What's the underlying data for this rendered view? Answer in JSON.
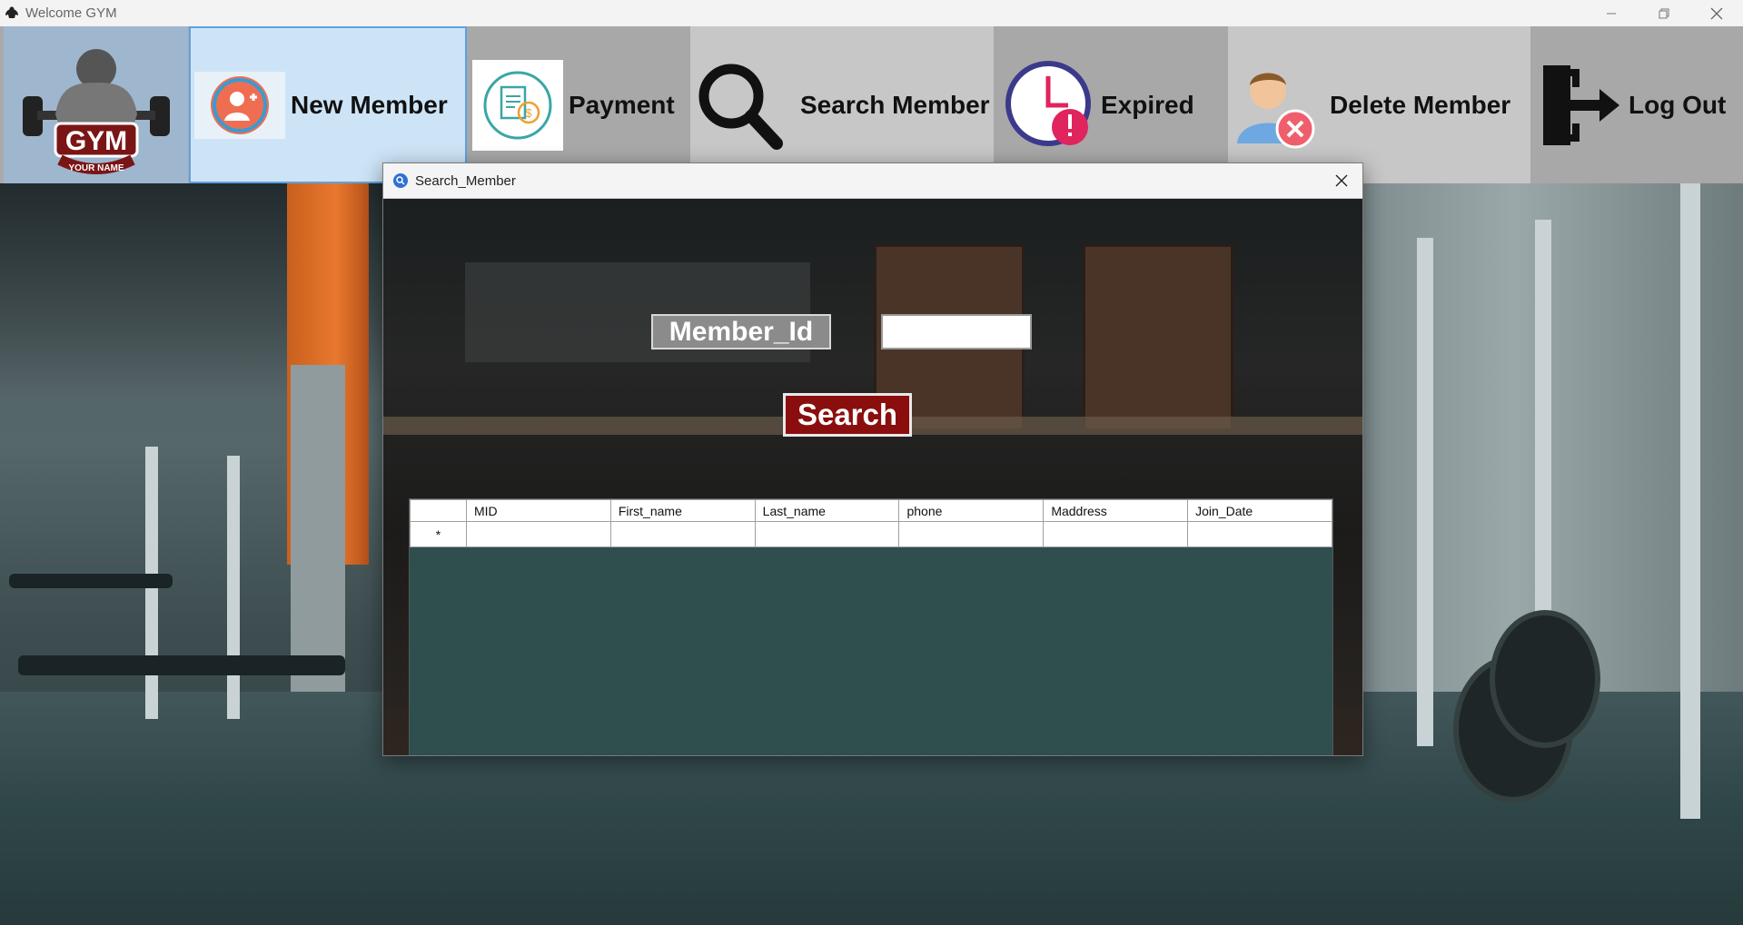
{
  "window": {
    "title": "Welcome GYM"
  },
  "toolbar": {
    "logo_alt": "GYM logo",
    "logo_text": "GYM",
    "logo_subtext": "YOUR NAME",
    "new_member": "New Member",
    "payment": "Payment",
    "search_member": "Search Member",
    "expired": "Expired",
    "delete_member": "Delete Member",
    "log_out": "Log Out"
  },
  "dialog": {
    "title": "Search_Member",
    "member_id_label": "Member_Id",
    "member_id_value": "",
    "search_button": "Search",
    "grid": {
      "columns": [
        "MID",
        "First_name",
        "Last_name",
        "phone",
        "Maddress",
        "Join_Date"
      ],
      "new_row_marker": "*"
    }
  },
  "colors": {
    "search_button_bg": "#8b0e0e",
    "grid_background": "#2f4f4f",
    "selected_tool_bg": "#cde4f7"
  }
}
